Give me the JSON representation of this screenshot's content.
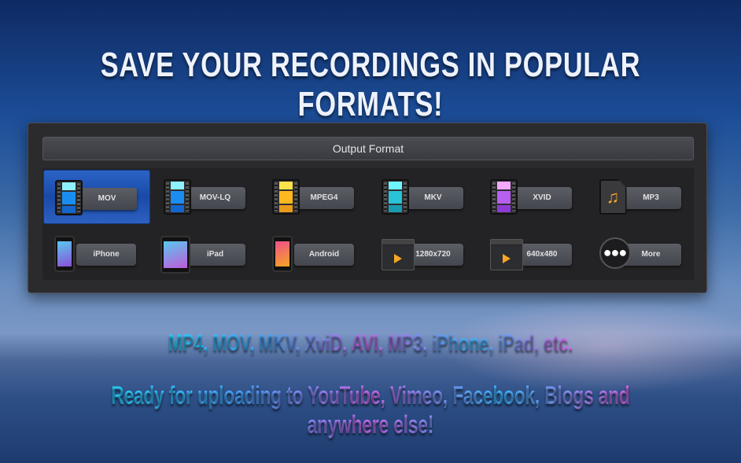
{
  "headline": "SAVE YOUR RECORDINGS IN POPULAR FORMATS!",
  "panel": {
    "title": "Output Format",
    "formats": [
      {
        "label": "MOV",
        "icon": "film-blue-icon",
        "selected": true,
        "colors": [
          "#8ff0ff",
          "#1a8ef0",
          "#1466cc"
        ]
      },
      {
        "label": "MOV-LQ",
        "icon": "film-blue-icon",
        "colors": [
          "#8ff0ff",
          "#1a8ef0",
          "#1466cc"
        ]
      },
      {
        "label": "MPEG4",
        "icon": "film-yellow-icon",
        "colors": [
          "#ffe24a",
          "#ffb81f",
          "#e89a1a"
        ]
      },
      {
        "label": "MKV",
        "icon": "film-cyan-icon",
        "colors": [
          "#6ff5ff",
          "#29c2d6",
          "#1a9cb0"
        ]
      },
      {
        "label": "XVID",
        "icon": "film-purple-icon",
        "colors": [
          "#f5a8ff",
          "#b660f0",
          "#8e3bd6"
        ]
      },
      {
        "label": "MP3",
        "icon": "music-file-icon"
      },
      {
        "label": "iPhone",
        "icon": "iphone-icon",
        "colors": [
          "#5ac8f0",
          "#8a4fd8"
        ]
      },
      {
        "label": "iPad",
        "icon": "ipad-icon",
        "colors": [
          "#5ac8f0",
          "#c05ad8"
        ]
      },
      {
        "label": "Android",
        "icon": "android-phone-icon",
        "colors": [
          "#f0508a",
          "#f5a623"
        ]
      },
      {
        "label": "1280x720",
        "icon": "video-window-icon"
      },
      {
        "label": "640x480",
        "icon": "video-window-icon"
      },
      {
        "label": "More",
        "icon": "more-dots-icon"
      }
    ]
  },
  "formats_line": "MP4, MOV, MKV, XviD, AVI, MP3, iPhone, iPad, etc.",
  "tagline": "Ready for uploading to YouTube, Vimeo, Facebook, Blogs and anywhere else!"
}
